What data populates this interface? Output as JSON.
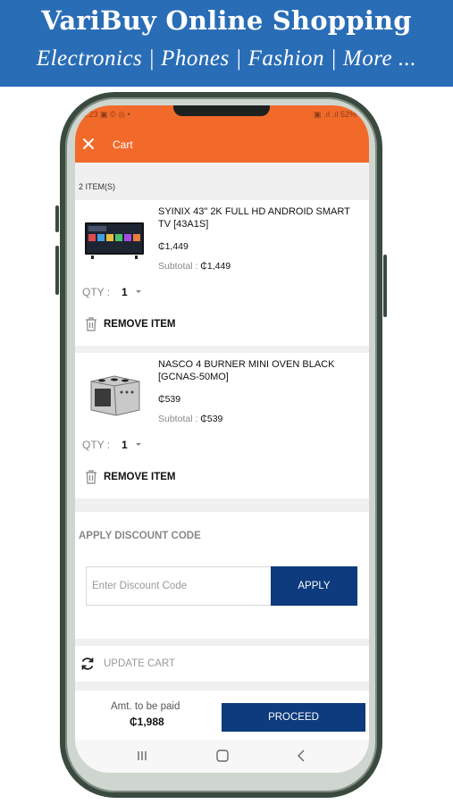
{
  "banner": {
    "title": "VariBuy Online Shopping",
    "subtitle": "Electronics | Phones | Fashion | More ..."
  },
  "status_bar": {
    "left": "2:23 ▣ © ◎ •",
    "right": "▣ .ıl .ıl 52%"
  },
  "app_bar": {
    "title": "Cart",
    "close_icon": "close-icon"
  },
  "cart": {
    "item_count": "2 ITEM(S)",
    "items": [
      {
        "name": "SYINIX 43\" 2K FULL HD ANDROID SMART TV [43A1S]",
        "price": "₵1,449",
        "subtotal_label": "Subtotal : ",
        "subtotal_value": "₵1,449",
        "qty_label": "QTY :",
        "qty_value": "1",
        "remove_label": "REMOVE ITEM",
        "image": "tv-image"
      },
      {
        "name": "NASCO 4 BURNER MINI OVEN BLACK [GCNAS-50MO]",
        "price": "₵539",
        "subtotal_label": "Subtotal : ",
        "subtotal_value": "₵539",
        "qty_label": "QTY :",
        "qty_value": "1",
        "remove_label": "REMOVE ITEM",
        "image": "oven-image"
      }
    ]
  },
  "discount": {
    "label": "APPLY DISCOUNT CODE",
    "placeholder": "Enter Discount Code",
    "value": "",
    "button": "APPLY"
  },
  "update": {
    "label": "UPDATE CART",
    "icon": "refresh-icon"
  },
  "footer": {
    "amt_label": "Amt. to be paid",
    "amt_value": "₵1,988",
    "proceed": "PROCEED"
  },
  "nav_bar": {
    "icons": [
      "recent-apps-icon",
      "home-icon",
      "back-icon"
    ]
  },
  "colors": {
    "banner": "#2a6db7",
    "app_bar": "#f26a2a",
    "primary_button": "#0d3b7d",
    "background": "#f0f0f0"
  }
}
